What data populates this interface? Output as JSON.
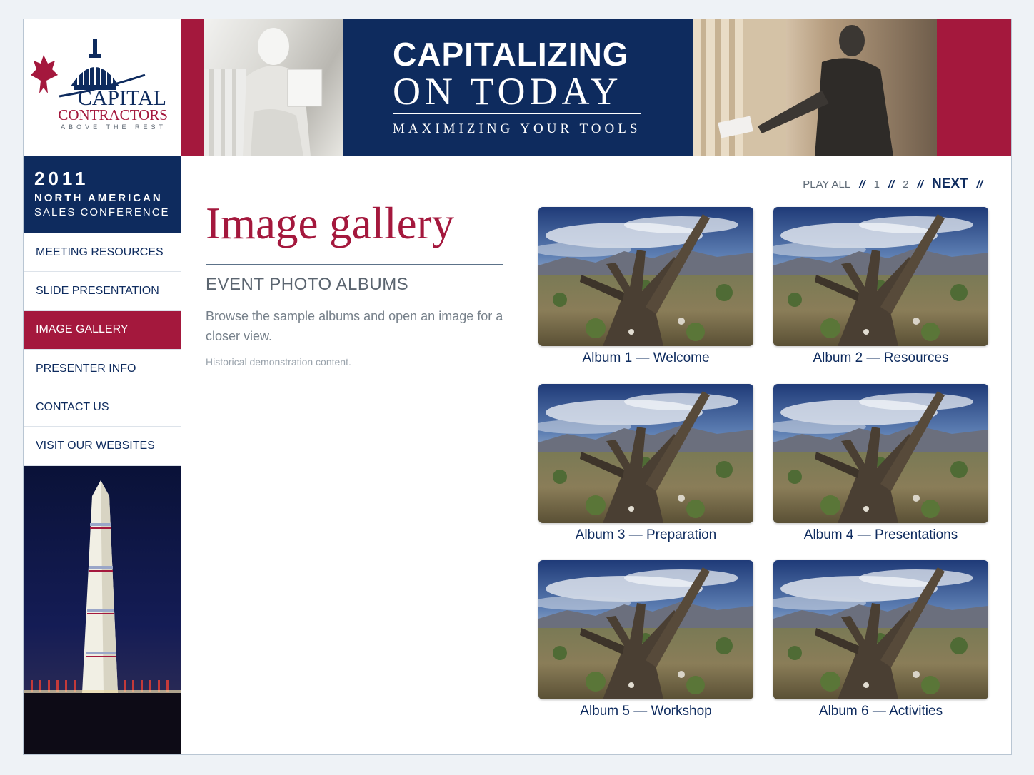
{
  "brand": {
    "name_line1": "CAPITAL",
    "name_line2": "CONTRACTORS",
    "tagline": "ABOVE THE REST",
    "colors": {
      "navy": "#0e2b5e",
      "crimson": "#a4183d"
    }
  },
  "banner": {
    "title_line1": "CAPITALIZING",
    "title_line2": "ON TODAY",
    "subtitle": "MAXIMIZING YOUR TOOLS"
  },
  "conference": {
    "year": "2011",
    "line1": "NORTH AMERICAN",
    "line2": "SALES CONFERENCE"
  },
  "nav": {
    "items": [
      {
        "label": "MEETING RESOURCES",
        "active": false
      },
      {
        "label": "SLIDE PRESENTATION",
        "active": false
      },
      {
        "label": "IMAGE GALLERY",
        "active": true
      },
      {
        "label": "PRESENTER INFO",
        "active": false
      },
      {
        "label": "CONTACT US",
        "active": false
      },
      {
        "label": "VISIT OUR WEBSITES",
        "active": false
      }
    ]
  },
  "pager": {
    "play_all": "PLAY ALL",
    "separator": "//",
    "page1": "1",
    "page2": "2",
    "next": "NEXT"
  },
  "main": {
    "title": "Image gallery",
    "section_heading": "EVENT PHOTO ALBUMS",
    "description": "Browse the sample albums and open an image for a closer view.",
    "note": "Historical demonstration content."
  },
  "albums": [
    {
      "label": "Album 1 — Welcome"
    },
    {
      "label": "Album 2 — Resources"
    },
    {
      "label": "Album 3 — Preparation"
    },
    {
      "label": "Album 4 — Presentations"
    },
    {
      "label": "Album 5 — Workshop"
    },
    {
      "label": "Album 6 — Activities"
    }
  ]
}
